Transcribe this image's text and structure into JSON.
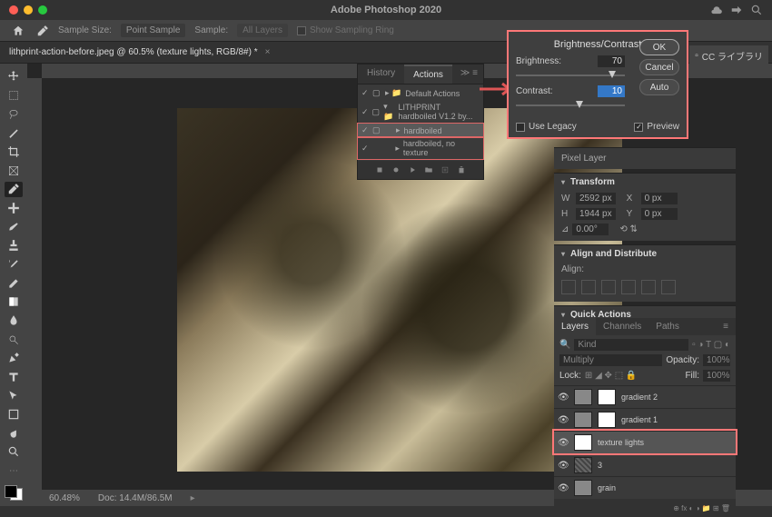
{
  "app_title": "Adobe Photoshop 2020",
  "options_bar": {
    "sample_size_label": "Sample Size:",
    "sample_size_value": "Point Sample",
    "sample_label": "Sample:",
    "sample_value": "All Layers",
    "show_ring": "Show Sampling Ring"
  },
  "document_tab": "lithprint-action-before.jpeg @ 60.5% (texture lights, RGB/8#) *",
  "status": {
    "zoom": "60.48%",
    "doc": "Doc: 14.4M/86.5M"
  },
  "actions_panel": {
    "tab_history": "History",
    "tab_actions": "Actions",
    "items": [
      {
        "label": "Default Actions",
        "checked": true
      },
      {
        "label": "LITHPRINT hardboiled V1.2 by...",
        "checked": true
      },
      {
        "label": "hardboiled",
        "checked": true,
        "sel": true
      },
      {
        "label": "hardboiled, no texture",
        "checked": true
      }
    ]
  },
  "bc": {
    "title": "Brightness/Contrast",
    "brightness_label": "Brightness:",
    "brightness_value": "70",
    "contrast_label": "Contrast:",
    "contrast_value": "10",
    "use_legacy": "Use Legacy",
    "preview": "Preview",
    "ok": "OK",
    "cancel": "Cancel",
    "auto": "Auto"
  },
  "properties": {
    "pixel_layer": "Pixel Layer",
    "transform": "Transform",
    "w": "2592 px",
    "h": "1944 px",
    "x": "0 px",
    "y": "0 px",
    "angle": "0.00°",
    "align": "Align and Distribute",
    "align_label": "Align:",
    "quick": "Quick Actions"
  },
  "layers": {
    "tab_layers": "Layers",
    "tab_channels": "Channels",
    "tab_paths": "Paths",
    "kind": "Kind",
    "blend": "Multiply",
    "opacity_label": "Opacity:",
    "opacity": "100%",
    "lock": "Lock:",
    "fill_label": "Fill:",
    "fill": "100%",
    "items": [
      {
        "name": "gradient 2"
      },
      {
        "name": "gradient 1"
      },
      {
        "name": "texture lights",
        "sel": true
      },
      {
        "name": "3"
      },
      {
        "name": "grain"
      }
    ]
  },
  "cc_lib": "CC ライブラリ"
}
